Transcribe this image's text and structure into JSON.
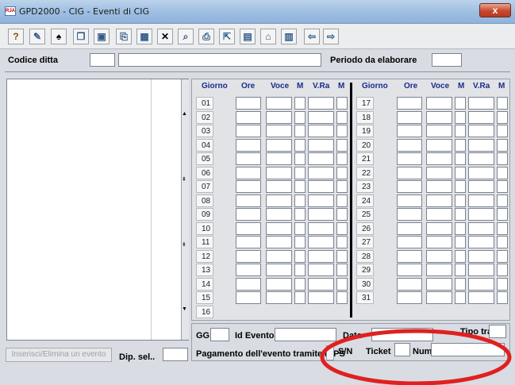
{
  "window": {
    "title": "GPD2000 - CIG - Eventi di CIG",
    "app_badge": "RJA",
    "close_label": "x"
  },
  "toolbar": {
    "buttons": [
      "help-icon",
      "edit-icon",
      "search-binoculars-icon",
      "copy-icon",
      "screen-icon",
      "paste-icon",
      "grid-icon",
      "delete-x-icon",
      "preview-icon",
      "print-icon",
      "export-icon",
      "form-icon",
      "open-folder-icon",
      "save-folder-icon",
      "arrow-left-icon",
      "arrow-right-icon"
    ]
  },
  "header": {
    "codice_ditta_label": "Codice ditta",
    "codice_ditta_value": "",
    "ditta_name_value": "",
    "periodo_label": "Periodo da elaborare",
    "periodo_value": ""
  },
  "grid": {
    "columns": {
      "giorno": "Giorno",
      "ore": "Ore",
      "voce": "Voce",
      "m": "M",
      "vra": "V.Ra",
      "m2": "M"
    },
    "left_days": [
      "01",
      "02",
      "03",
      "04",
      "05",
      "06",
      "07",
      "08",
      "09",
      "10",
      "11",
      "12",
      "13",
      "14",
      "15",
      "16"
    ],
    "right_days": [
      "17",
      "18",
      "19",
      "20",
      "21",
      "22",
      "23",
      "24",
      "25",
      "26",
      "27",
      "28",
      "29",
      "30",
      "31"
    ]
  },
  "bottom": {
    "gg_label": "GG",
    "gg_value": "",
    "id_evento_label": "Id Evento",
    "id_evento_value": "",
    "data_label": "Data",
    "data_value": "",
    "tipo_label": "Tipo tram",
    "tipo_value": "",
    "pagamento_label": "Pagamento dell'evento tramite INPS",
    "sn_label": "S/N",
    "ticket_label": "Ticket",
    "ticket_value": "",
    "num_label": "Num.",
    "num_value": "",
    "inserisci_button": "Inserisci/Elimina un evento",
    "dip_sel_label": "Dip. sel..",
    "dip_sel_value": ""
  },
  "annotation_color": "#e02020"
}
